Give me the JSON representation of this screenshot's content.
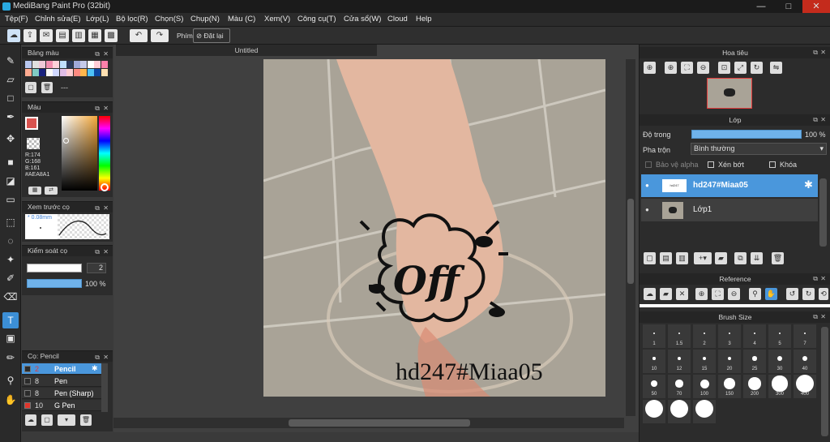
{
  "app": {
    "title": "MediBang Paint Pro (32bit)",
    "minimize": "—",
    "maximize": "□",
    "close": "✕"
  },
  "menu": [
    "Tệp(F)",
    "Chỉnh sửa(E)",
    "Lớp(L)",
    "Bộ lọc(R)",
    "Chọn(S)",
    "Chụp(N)",
    "Màu (C)",
    "Xem(V)",
    "Công cụ(T)",
    "Cửa sổ(W)",
    "Cloud",
    "Help"
  ],
  "toolbar": {
    "shortcut_label": "Phím",
    "reset_label": "Đặt lại"
  },
  "canvas": {
    "tab_title": "Untitled",
    "sticker_text": "Off",
    "watermark": "hd247#Miaa05"
  },
  "palette_panel": {
    "title": "Bảng màu",
    "slot_label": "---",
    "swatches": [
      "#b8c7f0",
      "#e0e0e0",
      "#f0c9d8",
      "#f48fb1",
      "#ffd0d8",
      "#bfe0ff",
      "#2a3a5a",
      "#9fa8da",
      "#c5cae9",
      "#ffffff",
      "#ffccd5",
      "#ff80ab",
      "#ffab91",
      "#80cbc4",
      "#1a237e",
      "#fafafa",
      "#d0d8ff",
      "#e1bee7",
      "#ffcdd2",
      "#ff8a80",
      "#ffb74d",
      "#4fc3f7",
      "#0d47a1",
      "#ffe0b2"
    ]
  },
  "color_panel": {
    "title": "Màu",
    "r": "R:174",
    "g": "G:168",
    "b": "B:161",
    "hex": "#AEA8A1",
    "primary": "#d9534f"
  },
  "preview_panel": {
    "title": "Xem trước cọ",
    "size": "0.08mm"
  },
  "brush_control": {
    "title": "Kiểm soát cọ",
    "size_value": "2",
    "opacity_value": "100 %"
  },
  "brush_list": {
    "title": "Cọ: Pencil",
    "items": [
      {
        "size": "2",
        "name": "Pencil",
        "color": "#2b2b2b",
        "selected": true
      },
      {
        "size": "8",
        "name": "Pen",
        "color": "#2b2b2b",
        "selected": false
      },
      {
        "size": "8",
        "name": "Pen (Sharp)",
        "color": "#2b2b2b",
        "selected": false
      },
      {
        "size": "10",
        "name": "G Pen",
        "color": "#e0362c",
        "selected": false
      }
    ]
  },
  "navigator": {
    "title": "Hoa tiêu"
  },
  "layers": {
    "title": "Lớp",
    "opacity_label": "Độ trong",
    "opacity_value": "100 %",
    "blend_label": "Pha trộn",
    "blend_value": "Bình thường",
    "protect_alpha": "Bảo vệ alpha",
    "clipping": "Xén bớt",
    "lock": "Khóa",
    "items": [
      {
        "name": "hd247#Miaa05",
        "selected": true
      },
      {
        "name": "Lớp1",
        "selected": false
      }
    ]
  },
  "reference": {
    "title": "Reference"
  },
  "brush_size": {
    "title": "Brush Size",
    "sizes": [
      "1",
      "1.5",
      "2",
      "3",
      "4",
      "5",
      "7",
      "10",
      "12",
      "15",
      "20",
      "25",
      "30",
      "40",
      "50",
      "70",
      "100",
      "150",
      "200",
      "300",
      "400",
      "",
      "",
      ""
    ]
  }
}
